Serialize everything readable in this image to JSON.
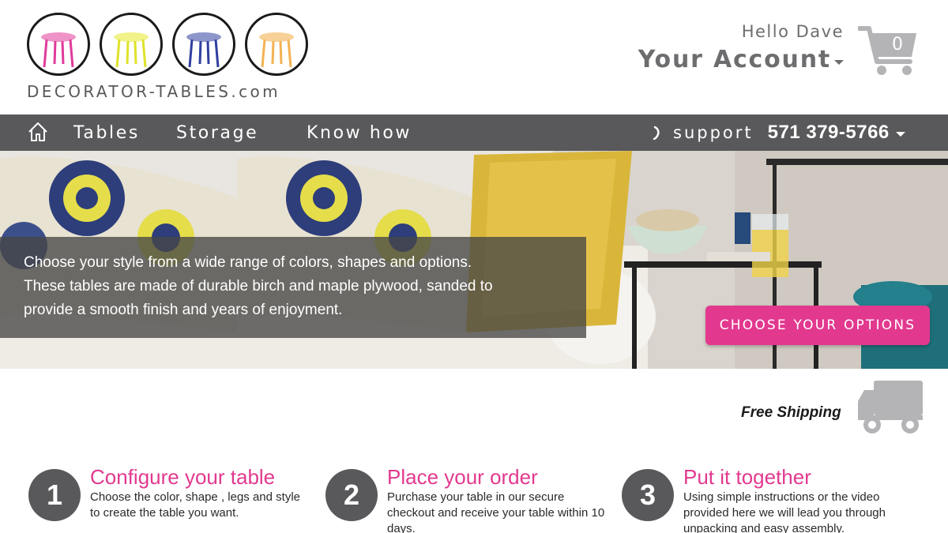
{
  "brand": {
    "logo_text": "DECORATOR-TABLES.com",
    "table_colors": [
      "#e03a9a",
      "#e7ea3a",
      "#2f3fa0",
      "#f4b254"
    ]
  },
  "account": {
    "greeting": "Hello Dave",
    "link_label": "Your Account",
    "cart_count": "0"
  },
  "nav": {
    "items": [
      {
        "label": "Tables"
      },
      {
        "label": "Storage"
      },
      {
        "label": "Know how"
      }
    ],
    "support_label": "support",
    "support_phone": "571 379-5766"
  },
  "hero": {
    "text_line1": "Choose your style from a wide range of colors, shapes and options.",
    "text_line2": "These tables are made of durable birch and maple plywood, sanded to",
    "text_line3": "provide a smooth finish and years of enjoyment.",
    "cta_label": "CHOOSE YOUR OPTIONS"
  },
  "shipping": {
    "label": "Free Shipping"
  },
  "steps": [
    {
      "number": "1",
      "title": "Configure your table",
      "desc": "Choose the color, shape , legs and style to create the table you want."
    },
    {
      "number": "2",
      "title": "Place your order",
      "desc": "Purchase your table in our secure checkout and receive your table within 10 days."
    },
    {
      "number": "3",
      "title": "Put it together",
      "desc": "Using simple instructions or the video provided here we will lead you through unpacking and easy assembly."
    }
  ],
  "colors": {
    "accent": "#e2398f",
    "nav_bg": "#59595b",
    "text_gray": "#6d6d70"
  }
}
